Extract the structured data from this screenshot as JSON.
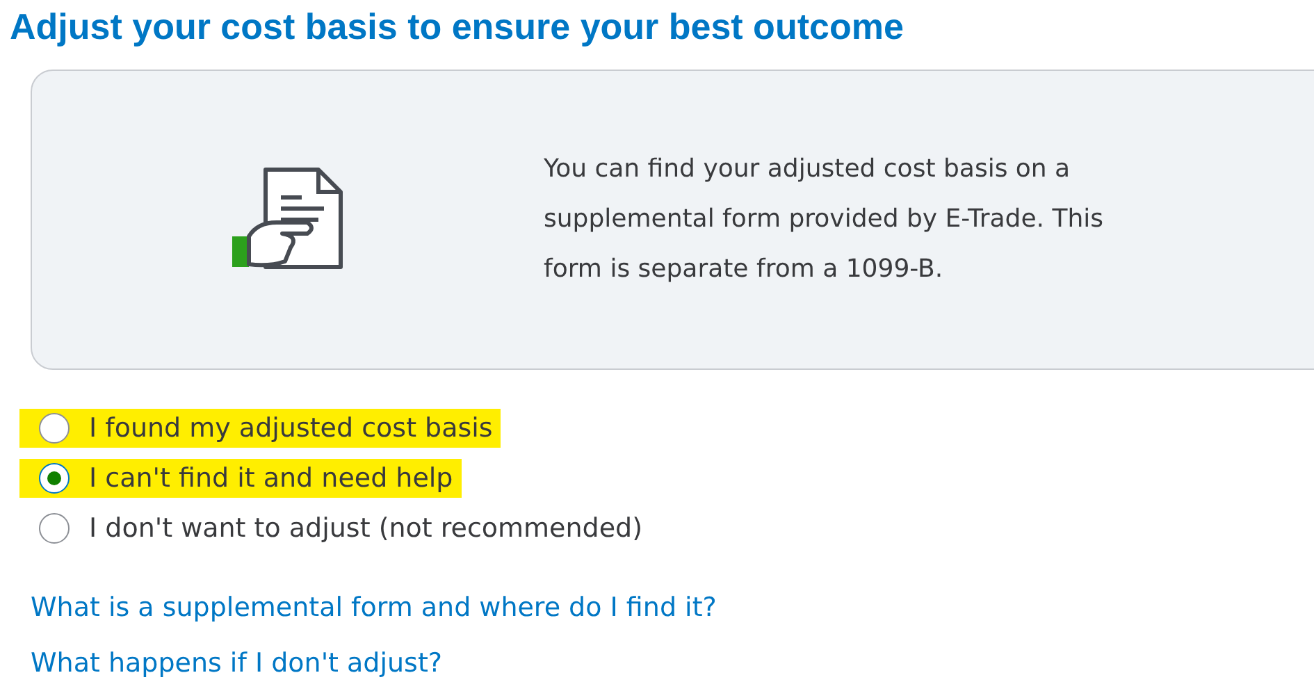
{
  "title": "Adjust your cost basis to ensure your best outcome",
  "info_card": {
    "text": "You can find your adjusted cost basis on a supplemental form provided by E-Trade. This form is separate from a 1099-B."
  },
  "options": [
    {
      "label": "I found my adjusted cost basis",
      "selected": false,
      "highlighted": true
    },
    {
      "label": "I can't find it and need help",
      "selected": true,
      "highlighted": true
    },
    {
      "label": "I don't want to adjust (not recommended)",
      "selected": false,
      "highlighted": false
    }
  ],
  "links": [
    "What is a supplemental form and where do I find it?",
    "What happens if I don't adjust?"
  ]
}
